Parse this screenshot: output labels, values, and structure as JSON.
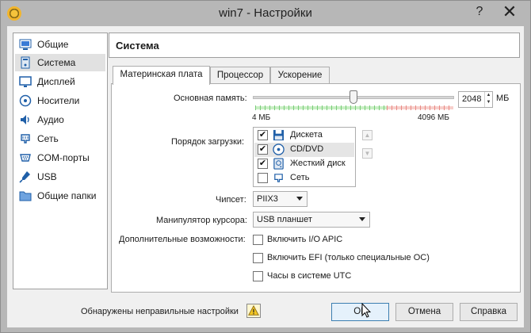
{
  "window": {
    "title": "win7 - Настройки",
    "help_symbol": "?",
    "close_symbol": "✕"
  },
  "sidebar": {
    "items": [
      {
        "label": "Общие",
        "icon": "general-icon"
      },
      {
        "label": "Система",
        "icon": "system-icon",
        "selected": true
      },
      {
        "label": "Дисплей",
        "icon": "display-icon"
      },
      {
        "label": "Носители",
        "icon": "storage-icon"
      },
      {
        "label": "Аудио",
        "icon": "audio-icon"
      },
      {
        "label": "Сеть",
        "icon": "network-icon"
      },
      {
        "label": "COM-порты",
        "icon": "serial-port-icon"
      },
      {
        "label": "USB",
        "icon": "usb-icon"
      },
      {
        "label": "Общие папки",
        "icon": "folder-icon"
      }
    ]
  },
  "header": {
    "title": "Система"
  },
  "tabs": [
    {
      "label": "Материнская плата",
      "active": true
    },
    {
      "label": "Процессор",
      "active": false
    },
    {
      "label": "Ускорение",
      "active": false
    }
  ],
  "motherboard": {
    "memory_label": "Основная память:",
    "memory_value": "2048",
    "memory_unit": "МБ",
    "memory_min_label": "4 МБ",
    "memory_max_label": "4096 МБ",
    "memory_fraction": 0.5,
    "boot_order_label": "Порядок загрузки:",
    "boot_items": [
      {
        "label": "Дискета",
        "checked": true,
        "icon": "floppy-icon"
      },
      {
        "label": "CD/DVD",
        "checked": true,
        "icon": "optical-disc-icon",
        "selected": true
      },
      {
        "label": "Жесткий диск",
        "checked": true,
        "icon": "hard-disk-icon"
      },
      {
        "label": "Сеть",
        "checked": false,
        "icon": "network-boot-icon"
      }
    ],
    "checkmark": "✔",
    "chipset_label": "Чипсет:",
    "chipset_value": "PIIX3",
    "pointing_label": "Манипулятор курсора:",
    "pointing_value": "USB планшет",
    "extended_label": "Дополнительные возможности:",
    "extended_options": [
      {
        "label": "Включить I/O APIC",
        "checked": false
      },
      {
        "label": "Включить EFI (только специальные ОС)",
        "checked": false
      },
      {
        "label": "Часы в системе UTC",
        "checked": false
      }
    ]
  },
  "footer": {
    "warning_text": "Обнаружены неправильные настройки",
    "ok_label": "OK",
    "cancel_label": "Отмена",
    "help_label": "Справка"
  },
  "colors": {
    "accent": "#3c7fb1",
    "green_band": "#c9efc4",
    "red_band": "#f7cfcb"
  }
}
